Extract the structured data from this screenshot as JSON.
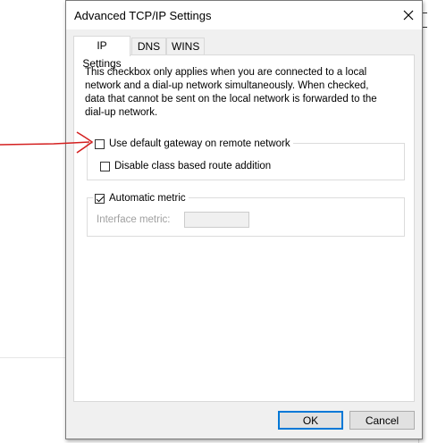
{
  "dialog": {
    "title": "Advanced TCP/IP Settings",
    "close_glyph": "close-icon"
  },
  "tabs": [
    {
      "label": "IP Settings",
      "active": true
    },
    {
      "label": "DNS",
      "active": false
    },
    {
      "label": "WINS",
      "active": false
    }
  ],
  "panel": {
    "description": "This checkbox only applies when you are connected to a local network and a dial-up network simultaneously.  When checked, data that cannot be sent on the local network is forwarded to the dial-up network.",
    "gateway_checkbox": {
      "label": "Use default gateway on remote network",
      "checked": false
    },
    "class_route_checkbox": {
      "label": "Disable class based route addition",
      "checked": false
    },
    "auto_metric_checkbox": {
      "label": "Automatic metric",
      "checked": true
    },
    "interface_metric": {
      "label": "Interface metric:",
      "value": ""
    }
  },
  "buttons": {
    "ok": "OK",
    "cancel": "Cancel"
  },
  "colors": {
    "annotation_arrow": "#d42020",
    "default_button_border": "#0078d7"
  }
}
